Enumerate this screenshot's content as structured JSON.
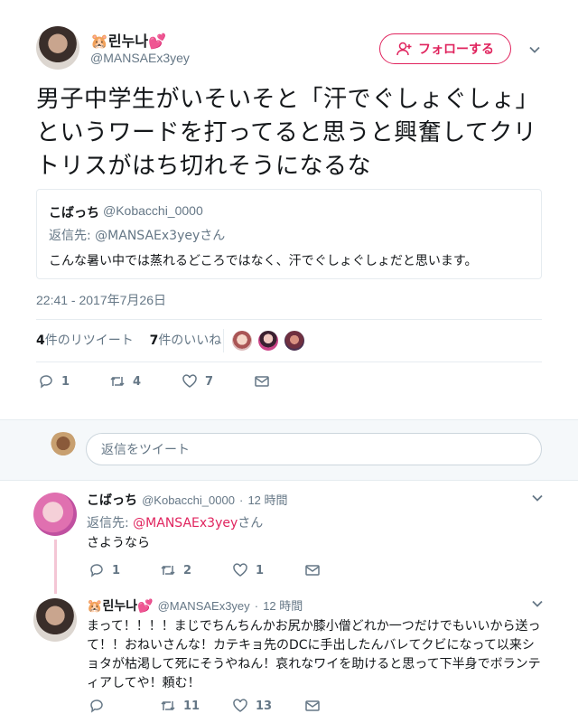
{
  "tweet": {
    "author_name": "린누나",
    "author_emoji": "🐹",
    "author_heart": "💕",
    "author_handle": "@MANSAEx3yey",
    "follow_label": "フォローする",
    "text": "男子中学生がいそいそと「汗でぐしょぐしょ」というワードを打ってると思うと興奮してクリトリスがはち切れそうになるな",
    "quote": {
      "name": "こばっち",
      "handle": "@Kobacchi_0000",
      "reply_prefix": "返信先:",
      "reply_to": "@MANSAEx3yeyさん",
      "text": "こんな暑い中では蒸れるどころではなく、汗でぐしょぐしょだと思います。"
    },
    "timestamp": "22:41 - 2017年7月26日",
    "retweets_count": "4",
    "retweets_label": "件のリツイート",
    "likes_count": "7",
    "likes_label": "件のいいね",
    "actions": {
      "reply": "1",
      "retweet": "4",
      "like": "7"
    }
  },
  "reply_box": {
    "placeholder": "返信をツイート"
  },
  "replies": [
    {
      "name": "こばっち",
      "handle": "@Kobacchi_0000",
      "time": "12 時間",
      "reply_prefix": "返信先:",
      "reply_to": "@MANSAEx3yey",
      "reply_suffix": "さん",
      "text": "さようなら",
      "actions": {
        "reply": "1",
        "retweet": "2",
        "like": "1"
      }
    },
    {
      "name": "린누나",
      "emoji": "🐹",
      "heart": "💕",
      "handle": "@MANSAEx3yey",
      "time": "12 時間",
      "text_lines": [
        "まって！！！！まじでちんちんかお尻か膝小僧どれか一つだけでもいいから送っ",
        "て！！おねいさんな！カテキョ先のDCに手出したんバレてクビになって以来シ",
        "ョタが枯渇して死にそうやねん！哀れなワイを助けると思って下半身でボランテ",
        "ィアしてや！頼む！"
      ],
      "actions": {
        "reply": "",
        "retweet": "11",
        "like": "13"
      }
    }
  ],
  "colors": {
    "accent": "#e0245e",
    "muted": "#657786",
    "divider": "#e6ecf0"
  },
  "icons": [
    "reply-icon",
    "retweet-icon",
    "like-icon",
    "message-icon",
    "chevron-down-icon",
    "add-user-icon"
  ]
}
